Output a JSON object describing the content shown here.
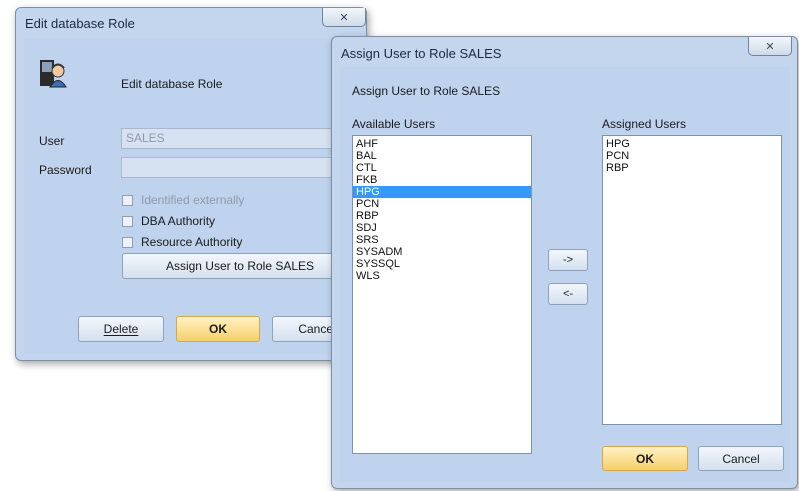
{
  "edit_dialog": {
    "window_title": "Edit database Role",
    "close_symbol": "✕",
    "heading": "Edit database Role",
    "user_label": "User",
    "user_value": "SALES",
    "password_label": "Password",
    "password_value": "",
    "identified_externally_label": "Identified externally",
    "dba_authority_label": "DBA Authority",
    "resource_authority_label": "Resource Authority",
    "assign_button_label": "Assign User to Role SALES",
    "delete_button_label": "Delete",
    "ok_button_label": "OK",
    "cancel_button_label": "Cancel",
    "icon": "users-icon"
  },
  "assign_dialog": {
    "window_title": "Assign User to Role SALES",
    "close_symbol": "✕",
    "heading": "Assign User to Role SALES",
    "available_label": "Available Users",
    "assigned_label": "Assigned Users",
    "available_users": [
      "AHF",
      "BAL",
      "CTL",
      "FKB",
      "HPG",
      "PCN",
      "RBP",
      "SDJ",
      "SRS",
      "SYSADM",
      "SYSSQL",
      "WLS"
    ],
    "selected_available": "HPG",
    "assigned_users": [
      "HPG",
      "PCN",
      "RBP"
    ],
    "add_button_label": "->",
    "remove_button_label": "<-",
    "ok_button_label": "OK",
    "cancel_button_label": "Cancel"
  },
  "colors": {
    "dialog_bg": "#bfd3ee",
    "selection": "#3399ff",
    "ok_button": "#f7cf6b"
  }
}
